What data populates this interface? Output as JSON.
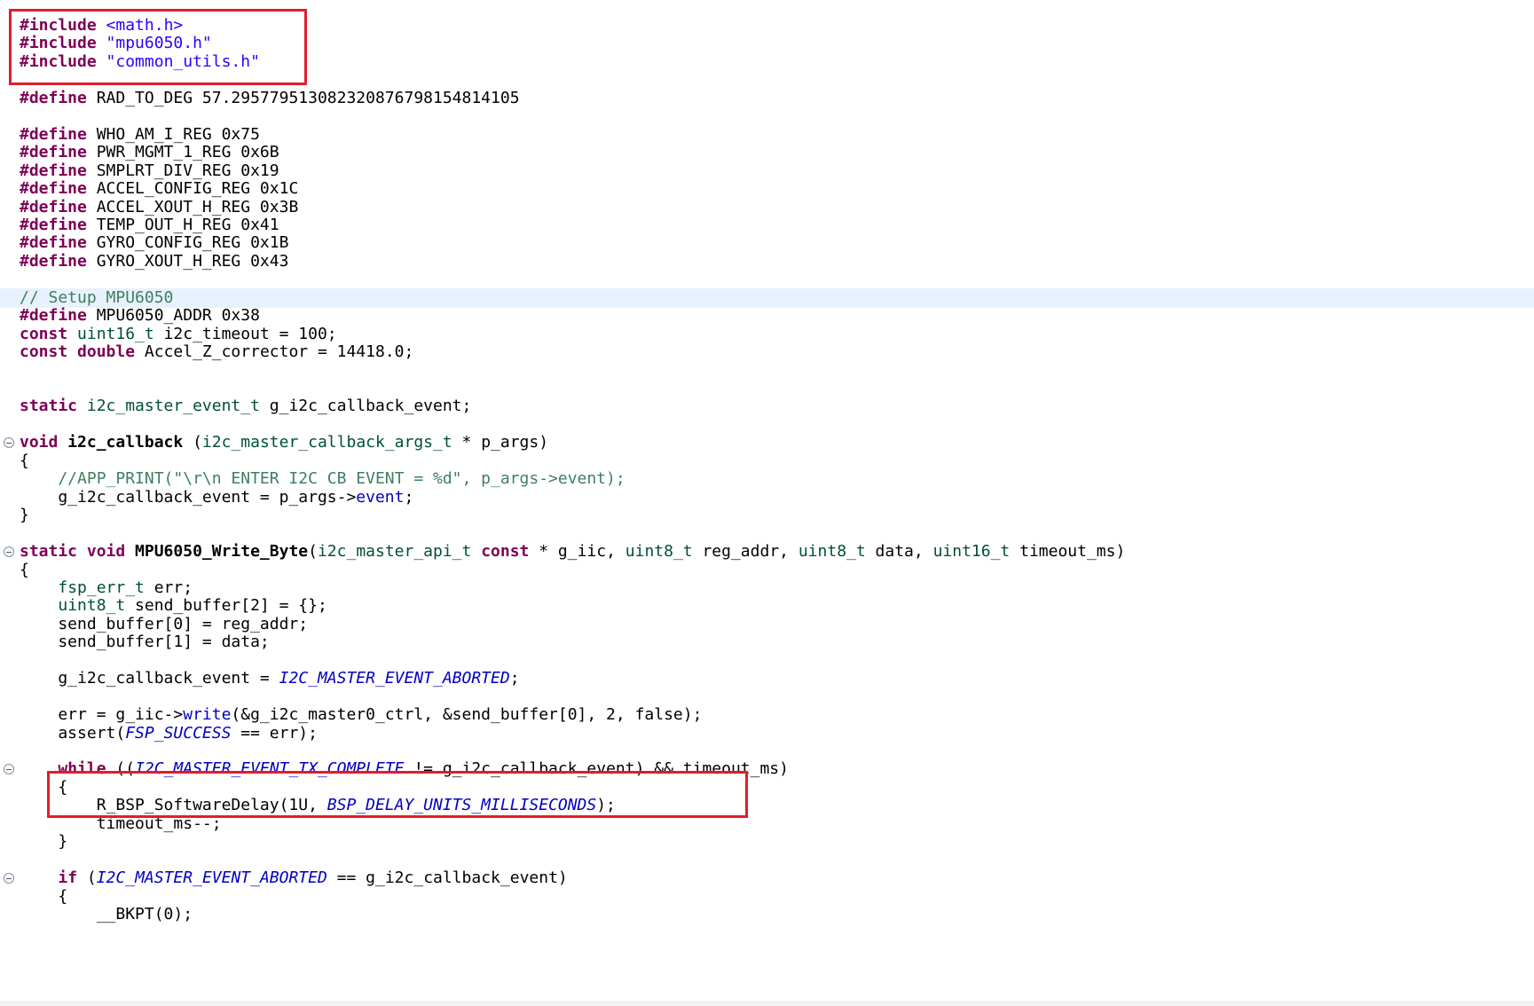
{
  "editor": {
    "lines": [
      {
        "tokens": [
          {
            "t": "#include ",
            "c": "kw"
          },
          {
            "t": "<math.h>",
            "c": "str"
          }
        ]
      },
      {
        "tokens": [
          {
            "t": "#include ",
            "c": "kw"
          },
          {
            "t": "\"mpu6050.h\"",
            "c": "str"
          }
        ]
      },
      {
        "tokens": [
          {
            "t": "#include ",
            "c": "kw"
          },
          {
            "t": "\"common_utils.h\"",
            "c": "str"
          }
        ]
      },
      {
        "tokens": []
      },
      {
        "tokens": [
          {
            "t": "#define ",
            "c": "kw"
          },
          {
            "t": "RAD_TO_DEG 57.2957795130823208767981548141​05",
            "c": "pl"
          }
        ]
      },
      {
        "tokens": []
      },
      {
        "tokens": [
          {
            "t": "#define ",
            "c": "kw"
          },
          {
            "t": "WHO_AM_I_REG 0x75",
            "c": "pl"
          }
        ]
      },
      {
        "tokens": [
          {
            "t": "#define ",
            "c": "kw"
          },
          {
            "t": "PWR_MGMT_1_REG 0x6B",
            "c": "pl"
          }
        ]
      },
      {
        "tokens": [
          {
            "t": "#define ",
            "c": "kw"
          },
          {
            "t": "SMPLRT_DIV_REG 0x19",
            "c": "pl"
          }
        ]
      },
      {
        "tokens": [
          {
            "t": "#define ",
            "c": "kw"
          },
          {
            "t": "ACCEL_CONFIG_REG 0x1C",
            "c": "pl"
          }
        ]
      },
      {
        "tokens": [
          {
            "t": "#define ",
            "c": "kw"
          },
          {
            "t": "ACCEL_XOUT_H_REG 0x3B",
            "c": "pl"
          }
        ]
      },
      {
        "tokens": [
          {
            "t": "#define ",
            "c": "kw"
          },
          {
            "t": "TEMP_OUT_H_REG 0x41",
            "c": "pl"
          }
        ]
      },
      {
        "tokens": [
          {
            "t": "#define ",
            "c": "kw"
          },
          {
            "t": "GYRO_CONFIG_REG 0x1B",
            "c": "pl"
          }
        ]
      },
      {
        "tokens": [
          {
            "t": "#define ",
            "c": "kw"
          },
          {
            "t": "GYRO_XOUT_H_REG 0x43",
            "c": "pl"
          }
        ]
      },
      {
        "tokens": []
      },
      {
        "highlight": true,
        "tokens": [
          {
            "t": "// Setup MPU6050",
            "c": "cm"
          }
        ]
      },
      {
        "tokens": [
          {
            "t": "#define ",
            "c": "kw"
          },
          {
            "t": "MPU6050_ADDR 0x38",
            "c": "pl"
          }
        ]
      },
      {
        "tokens": [
          {
            "t": "const ",
            "c": "kw"
          },
          {
            "t": "uint16_t",
            "c": "ty"
          },
          {
            "t": " i2c_timeout = 100;",
            "c": "pl"
          }
        ]
      },
      {
        "tokens": [
          {
            "t": "const ",
            "c": "kw"
          },
          {
            "t": "double",
            "c": "kw"
          },
          {
            "t": " Accel_Z_corrector = 14418.0;",
            "c": "pl"
          }
        ]
      },
      {
        "tokens": []
      },
      {
        "tokens": []
      },
      {
        "tokens": [
          {
            "t": "static ",
            "c": "kw"
          },
          {
            "t": "i2c_master_event_t",
            "c": "ty"
          },
          {
            "t": " g_i2c_callback_event;",
            "c": "pl"
          }
        ]
      },
      {
        "tokens": []
      },
      {
        "fold": true,
        "tokens": [
          {
            "t": "void ",
            "c": "kw"
          },
          {
            "t": "i2c_callback",
            "c": "fn"
          },
          {
            "t": " (",
            "c": "pl"
          },
          {
            "t": "i2c_master_callback_args_t",
            "c": "ty"
          },
          {
            "t": " * p_args)",
            "c": "pl"
          }
        ]
      },
      {
        "tokens": [
          {
            "t": "{",
            "c": "pl"
          }
        ]
      },
      {
        "tokens": [
          {
            "t": "    //APP_PRINT(\"\\r\\n ENTER I2C CB EVENT = %d\", p_args->event);",
            "c": "cm"
          }
        ]
      },
      {
        "tokens": [
          {
            "t": "    g_i2c_callback_event = p_args->",
            "c": "pl"
          },
          {
            "t": "event",
            "c": "fld"
          },
          {
            "t": ";",
            "c": "pl"
          }
        ]
      },
      {
        "tokens": [
          {
            "t": "}",
            "c": "pl"
          }
        ]
      },
      {
        "tokens": []
      },
      {
        "fold": true,
        "tokens": [
          {
            "t": "static ",
            "c": "kw"
          },
          {
            "t": "void ",
            "c": "kw"
          },
          {
            "t": "MPU6050_Write_Byte",
            "c": "fn"
          },
          {
            "t": "(",
            "c": "pl"
          },
          {
            "t": "i2c_master_api_t",
            "c": "ty"
          },
          {
            "t": " ",
            "c": "pl"
          },
          {
            "t": "const",
            "c": "kw"
          },
          {
            "t": " * g_iic, ",
            "c": "pl"
          },
          {
            "t": "uint8_t",
            "c": "ty"
          },
          {
            "t": " reg_addr, ",
            "c": "pl"
          },
          {
            "t": "uint8_t",
            "c": "ty"
          },
          {
            "t": " data, ",
            "c": "pl"
          },
          {
            "t": "uint16_t",
            "c": "ty"
          },
          {
            "t": " timeout_ms)",
            "c": "pl"
          }
        ]
      },
      {
        "tokens": [
          {
            "t": "{",
            "c": "pl"
          }
        ]
      },
      {
        "tokens": [
          {
            "t": "    ",
            "c": "pl"
          },
          {
            "t": "fsp_err_t",
            "c": "ty"
          },
          {
            "t": " err;",
            "c": "pl"
          }
        ]
      },
      {
        "tokens": [
          {
            "t": "    ",
            "c": "pl"
          },
          {
            "t": "uint8_t",
            "c": "ty"
          },
          {
            "t": " send_buffer[2] = {};",
            "c": "pl"
          }
        ]
      },
      {
        "tokens": [
          {
            "t": "    send_buffer[0] = reg_addr;",
            "c": "pl"
          }
        ]
      },
      {
        "tokens": [
          {
            "t": "    send_buffer[1] = data;",
            "c": "pl"
          }
        ]
      },
      {
        "tokens": []
      },
      {
        "tokens": [
          {
            "t": "    g_i2c_callback_event = ",
            "c": "pl"
          },
          {
            "t": "I2C_MASTER_EVENT_ABORTED",
            "c": "en"
          },
          {
            "t": ";",
            "c": "pl"
          }
        ]
      },
      {
        "tokens": []
      },
      {
        "tokens": [
          {
            "t": "    err = g_iic->",
            "c": "pl"
          },
          {
            "t": "write",
            "c": "fld"
          },
          {
            "t": "(&g_i2c_master0_ctrl, &send_buffer[0], 2, false);",
            "c": "pl"
          }
        ]
      },
      {
        "tokens": [
          {
            "t": "    assert(",
            "c": "pl"
          },
          {
            "t": "FSP_SUCCESS",
            "c": "en"
          },
          {
            "t": " == err);",
            "c": "pl"
          }
        ]
      },
      {
        "tokens": []
      },
      {
        "fold": true,
        "tokens": [
          {
            "t": "    ",
            "c": "pl"
          },
          {
            "t": "while",
            "c": "kw"
          },
          {
            "t": " ((",
            "c": "pl"
          },
          {
            "t": "I2C_MASTER_EVENT_TX_COMPLETE",
            "c": "en"
          },
          {
            "t": " != g_i2c_callback_event) && timeout_ms)",
            "c": "pl"
          }
        ]
      },
      {
        "tokens": [
          {
            "t": "    {",
            "c": "pl"
          }
        ]
      },
      {
        "tokens": [
          {
            "t": "        R_BSP_SoftwareDelay(1U, ",
            "c": "pl"
          },
          {
            "t": "BSP_DELAY_UNITS_MILLISECONDS",
            "c": "en"
          },
          {
            "t": ");",
            "c": "pl"
          }
        ]
      },
      {
        "tokens": [
          {
            "t": "        timeout_ms--;",
            "c": "pl"
          }
        ]
      },
      {
        "tokens": [
          {
            "t": "    }",
            "c": "pl"
          }
        ]
      },
      {
        "tokens": []
      },
      {
        "fold": true,
        "tokens": [
          {
            "t": "    ",
            "c": "pl"
          },
          {
            "t": "if",
            "c": "kw"
          },
          {
            "t": " (",
            "c": "pl"
          },
          {
            "t": "I2C_MASTER_EVENT_ABORTED",
            "c": "en"
          },
          {
            "t": " == g_i2c_callback_event)",
            "c": "pl"
          }
        ]
      },
      {
        "tokens": [
          {
            "t": "    {",
            "c": "pl"
          }
        ]
      },
      {
        "tokens": [
          {
            "t": "        __BKPT(0);",
            "c": "pl"
          }
        ]
      }
    ]
  },
  "annotations": {
    "box_color": "#e11d2c"
  },
  "colors": {
    "keyword": "#7f0055",
    "string": "#2a00ff",
    "comment": "#3f7f5f",
    "type": "#005032",
    "field": "#0000c0",
    "enum": "#0000c0",
    "current_line": "#e8f2fe"
  }
}
